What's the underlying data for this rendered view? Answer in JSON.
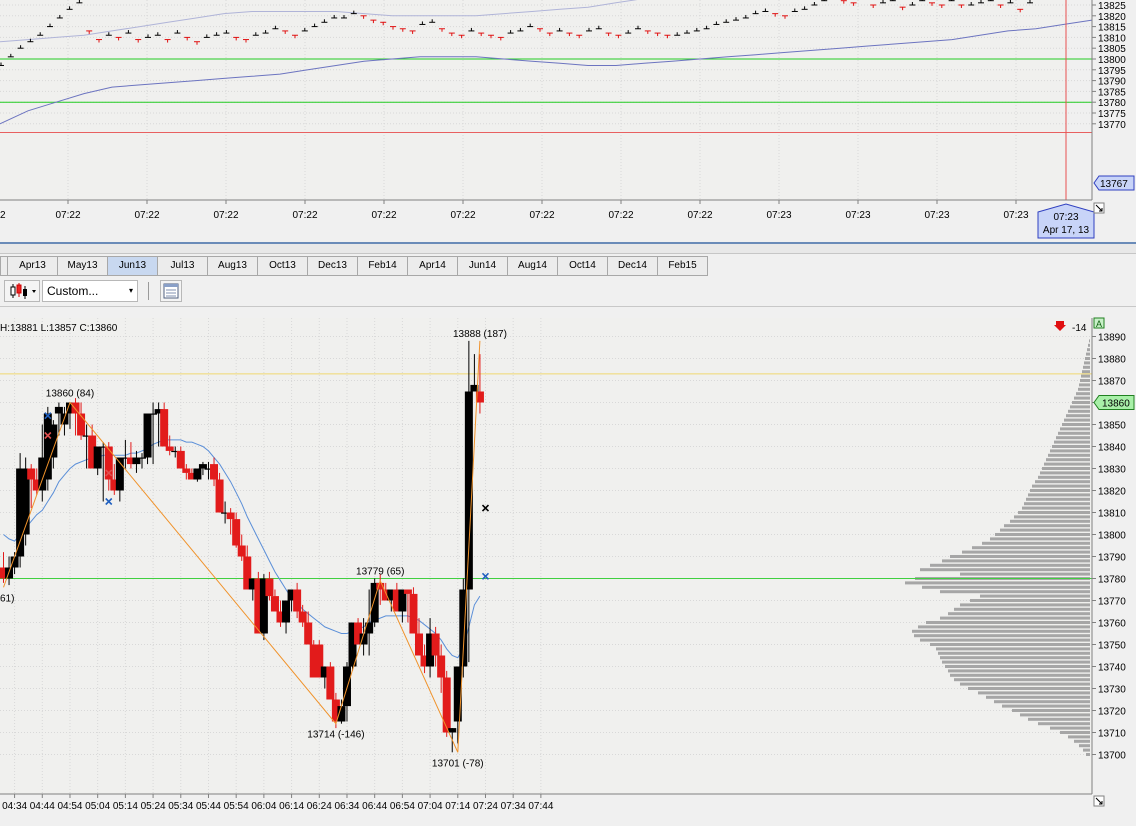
{
  "tick_chart": {
    "price_labels": [
      "13825",
      "13820",
      "13815",
      "13810",
      "13805",
      "13800",
      "13795",
      "13790",
      "13785",
      "13780",
      "13775",
      "13770"
    ],
    "time_labels": [
      "07:22",
      "07:22",
      "07:22",
      "07:22",
      "07:22",
      "07:22",
      "07:22",
      "07:22",
      "07:22",
      "07:23",
      "07:23",
      "07:23",
      "07:23"
    ],
    "left_edge_label": "2",
    "current_price": "13767",
    "cursor_time": "07:23",
    "cursor_date": "Apr 17, 13",
    "colors": {
      "line": "#22cc22",
      "upper_band": "#b0b4d8",
      "lower_band": "#6c74c0",
      "up_tick": "#000000",
      "down_tick": "#e01010",
      "price_badge": "#c8d4f8"
    }
  },
  "contract_tabs": [
    "Apr13",
    "May13",
    "Jun13",
    "Jul13",
    "Aug13",
    "Oct13",
    "Dec13",
    "Feb14",
    "Apr14",
    "Jun14",
    "Aug14",
    "Oct14",
    "Dec14",
    "Feb15"
  ],
  "selected_contract": "Jun13",
  "toolbar": {
    "template_label": "Custom...",
    "template_chevron": "▾"
  },
  "main_chart": {
    "ohlc_text": "H:13881 L:13857 C:13860",
    "price_labels": [
      "13890",
      "13880",
      "13870",
      "13860",
      "13850",
      "13840",
      "13830",
      "13820",
      "13810",
      "13800",
      "13790",
      "13780",
      "13770",
      "13760",
      "13750",
      "13740",
      "13730",
      "13720",
      "13710",
      "13700"
    ],
    "time_labels": [
      "04:34",
      "04:44",
      "04:54",
      "05:04",
      "05:14",
      "05:24",
      "05:34",
      "05:44",
      "05:54",
      "06:04",
      "06:14",
      "06:24",
      "06:34",
      "06:44",
      "06:54",
      "07:04",
      "07:14",
      "07:24",
      "07:34",
      "07:44"
    ],
    "current_price": "13860",
    "net_change": "-14",
    "axis_button": "A",
    "swing_labels": [
      "13860 (84)",
      "13714 (-146)",
      "13779 (65)",
      "13701 (-78)",
      "13888 (187)"
    ],
    "left_swing_fragment": "61)",
    "colors": {
      "up": "#000000",
      "down": "#e21b1b",
      "ma": "#5b8fd8",
      "zigzag": "#f0922a",
      "level": "#40d040",
      "price_badge": "#a8f0a8"
    }
  },
  "chart_data": [
    {
      "type": "candlestick",
      "title": "",
      "xlabel": "",
      "ylabel": "",
      "x": [
        "04:30",
        "04:32",
        "04:34",
        "04:36",
        "04:38",
        "04:40",
        "04:42",
        "04:44",
        "04:46",
        "04:48",
        "04:50",
        "04:52",
        "04:54",
        "04:56",
        "04:58",
        "05:00",
        "05:02",
        "05:04",
        "05:06",
        "05:08",
        "05:10",
        "05:12",
        "05:14",
        "05:16",
        "05:18",
        "05:20",
        "05:22",
        "05:24",
        "05:26",
        "05:28",
        "05:30",
        "05:32",
        "05:34",
        "05:36",
        "05:38",
        "05:40",
        "05:42",
        "05:44",
        "05:46",
        "05:48",
        "05:50",
        "05:52",
        "05:54",
        "05:56",
        "05:58",
        "06:00",
        "06:02",
        "06:04",
        "06:06",
        "06:08",
        "06:10",
        "06:12",
        "06:14",
        "06:16",
        "06:18",
        "06:20",
        "06:22",
        "06:24",
        "06:26",
        "06:28",
        "06:30",
        "06:32",
        "06:34",
        "06:36",
        "06:38",
        "06:40",
        "06:42",
        "06:44",
        "06:46",
        "06:48",
        "06:50",
        "06:52",
        "06:54",
        "06:56",
        "06:58",
        "07:00",
        "07:02",
        "07:04",
        "07:06",
        "07:08",
        "07:10",
        "07:12",
        "07:14",
        "07:16",
        "07:18",
        "07:20",
        "07:22",
        "07:24"
      ],
      "open": [
        13785,
        13780,
        13785,
        13790,
        13800,
        13830,
        13825,
        13820,
        13825,
        13835,
        13855,
        13850,
        13855,
        13860,
        13855,
        13845,
        13845,
        13830,
        13840,
        13840,
        13825,
        13820,
        13835,
        13835,
        13832,
        13835,
        13835,
        13855,
        13855,
        13857,
        13840,
        13838,
        13838,
        13830,
        13828,
        13825,
        13830,
        13830,
        13832,
        13825,
        13810,
        13810,
        13807,
        13795,
        13790,
        13775,
        13780,
        13755,
        13780,
        13772,
        13765,
        13760,
        13770,
        13775,
        13765,
        13760,
        13750,
        13750,
        13735,
        13740,
        13725,
        13715,
        13722,
        13740,
        13760,
        13750,
        13755,
        13760,
        13778,
        13775,
        13770,
        13775,
        13765,
        13775,
        13773,
        13755,
        13745,
        13740,
        13755,
        13745,
        13735,
        13710,
        13715,
        13740,
        13775,
        13865,
        13865
      ],
      "high": [
        13792,
        13790,
        13792,
        13837,
        13835,
        13832,
        13830,
        13850,
        13858,
        13852,
        13860,
        13858,
        13860,
        13862,
        13860,
        13850,
        13850,
        13840,
        13842,
        13842,
        13832,
        13826,
        13843,
        13842,
        13838,
        13837,
        13840,
        13860,
        13860,
        13860,
        13845,
        13840,
        13840,
        13832,
        13830,
        13830,
        13833,
        13833,
        13835,
        13828,
        13815,
        13812,
        13810,
        13800,
        13795,
        13780,
        13783,
        13782,
        13783,
        13775,
        13770,
        13765,
        13775,
        13778,
        13768,
        13765,
        13752,
        13752,
        13740,
        13742,
        13728,
        13725,
        13742,
        13760,
        13762,
        13762,
        13775,
        13780,
        13782,
        13778,
        13775,
        13778,
        13775,
        13775,
        13776,
        13762,
        13750,
        13762,
        13758,
        13750,
        13738,
        13712,
        13740,
        13780,
        13888,
        13882,
        13882
      ],
      "low": [
        13778,
        13777,
        13782,
        13785,
        13795,
        13812,
        13818,
        13815,
        13820,
        13830,
        13845,
        13845,
        13848,
        13845,
        13843,
        13830,
        13830,
        13827,
        13815,
        13820,
        13818,
        13815,
        13830,
        13830,
        13828,
        13830,
        13832,
        13832,
        13840,
        13853,
        13836,
        13835,
        13830,
        13825,
        13825,
        13824,
        13827,
        13825,
        13822,
        13810,
        13805,
        13800,
        13794,
        13788,
        13775,
        13770,
        13768,
        13752,
        13770,
        13765,
        13758,
        13755,
        13765,
        13762,
        13758,
        13750,
        13735,
        13735,
        13730,
        13725,
        13712,
        13714,
        13715,
        13738,
        13750,
        13745,
        13745,
        13758,
        13768,
        13770,
        13765,
        13767,
        13760,
        13760,
        13755,
        13745,
        13737,
        13735,
        13740,
        13728,
        13708,
        13701,
        13705,
        13735,
        13742,
        13865,
        13855
      ],
      "close": [
        13780,
        13785,
        13790,
        13830,
        13830,
        13825,
        13820,
        13835,
        13855,
        13850,
        13858,
        13855,
        13860,
        13855,
        13845,
        13845,
        13830,
        13840,
        13840,
        13825,
        13820,
        13835,
        13835,
        13832,
        13835,
        13835,
        13855,
        13855,
        13857,
        13840,
        13838,
        13838,
        13830,
        13828,
        13825,
        13830,
        13832,
        13830,
        13825,
        13810,
        13810,
        13807,
        13795,
        13790,
        13775,
        13780,
        13755,
        13780,
        13772,
        13765,
        13760,
        13770,
        13775,
        13765,
        13760,
        13750,
        13735,
        13735,
        13740,
        13725,
        13715,
        13722,
        13740,
        13760,
        13750,
        13755,
        13760,
        13778,
        13775,
        13770,
        13775,
        13765,
        13775,
        13773,
        13755,
        13745,
        13740,
        13755,
        13745,
        13735,
        13710,
        13712,
        13740,
        13775,
        13865,
        13868,
        13860
      ],
      "series": [
        {
          "name": "",
          "kind": "moving-average",
          "values": [
            13800,
            13798,
            13797,
            13800,
            13803,
            13806,
            13809,
            13811,
            13815,
            13819,
            13824,
            13827,
            13830,
            13832,
            13833,
            13834,
            13835,
            13835,
            13836,
            13836,
            13836,
            13836,
            13836,
            13837,
            13837,
            13838,
            13839,
            13841,
            13842,
            13843,
            13843,
            13843,
            13843,
            13842,
            13842,
            13841,
            13840,
            13838,
            13835,
            13832,
            13828,
            13824,
            13819,
            13814,
            13808,
            13803,
            13798,
            13793,
            13788,
            13783,
            13779,
            13775,
            13771,
            13769,
            13766,
            13764,
            13762,
            13760,
            13758,
            13757,
            13756,
            13755,
            13755,
            13756,
            13757,
            13758,
            13760,
            13761,
            13762,
            13763,
            13763,
            13763,
            13763,
            13763,
            13762,
            13761,
            13759,
            13757,
            13755,
            13752,
            13748,
            13745,
            13744,
            13748,
            13758,
            13768,
            13772
          ]
        },
        {
          "name": "",
          "kind": "zigzag",
          "x": [
            "04:30",
            "04:54",
            "06:30",
            "06:46",
            "07:14",
            "07:22"
          ],
          "values": [
            13776,
            13860,
            13714,
            13779,
            13701,
            13888
          ]
        }
      ],
      "horizontal_lines": [
        13780,
        13873
      ],
      "volume_profile": {
        "prices": [
          13700,
          13702,
          13704,
          13706,
          13708,
          13710,
          13712,
          13714,
          13716,
          13718,
          13720,
          13722,
          13724,
          13726,
          13728,
          13730,
          13732,
          13734,
          13736,
          13738,
          13740,
          13742,
          13744,
          13746,
          13748,
          13750,
          13752,
          13754,
          13756,
          13758,
          13760,
          13762,
          13764,
          13766,
          13768,
          13770,
          13772,
          13774,
          13776,
          13778,
          13780,
          13782,
          13784,
          13786,
          13788,
          13790,
          13792,
          13794,
          13796,
          13798,
          13800,
          13802,
          13804,
          13806,
          13808,
          13810,
          13812,
          13814,
          13816,
          13818,
          13820,
          13822,
          13824,
          13826,
          13828,
          13830,
          13832,
          13834,
          13836,
          13838,
          13840,
          13842,
          13844,
          13846,
          13848,
          13850,
          13852,
          13854,
          13856,
          13858,
          13860,
          13862,
          13864,
          13866,
          13868,
          13870,
          13872,
          13874,
          13876,
          13878,
          13880,
          13882,
          13884,
          13886,
          13888
        ],
        "volumes": [
          4,
          7,
          11,
          16,
          22,
          30,
          40,
          52,
          62,
          70,
          78,
          88,
          96,
          104,
          112,
          122,
          130,
          136,
          140,
          142,
          145,
          148,
          150,
          152,
          154,
          160,
          170,
          176,
          178,
          172,
          164,
          150,
          142,
          136,
          130,
          120,
          110,
          150,
          168,
          185,
          175,
          130,
          170,
          160,
          148,
          140,
          128,
          118,
          108,
          100,
          95,
          90,
          86,
          80,
          76,
          72,
          68,
          66,
          64,
          62,
          60,
          58,
          55,
          52,
          50,
          48,
          46,
          44,
          42,
          40,
          38,
          36,
          34,
          32,
          30,
          28,
          26,
          24,
          22,
          20,
          18,
          16,
          14,
          12,
          11,
          10,
          9,
          8,
          7,
          6,
          5,
          4,
          3,
          2,
          1
        ]
      },
      "markers": [
        {
          "x": "04:46",
          "price": 13854,
          "symbol": "×",
          "color": "#2060c0"
        },
        {
          "x": "04:46",
          "price": 13845,
          "symbol": "×",
          "color": "#e05050"
        },
        {
          "x": "05:08",
          "price": 13828,
          "symbol": "×",
          "color": "#e05050"
        },
        {
          "x": "05:08",
          "price": 13815,
          "symbol": "×",
          "color": "#2060c0"
        },
        {
          "x": "07:24",
          "price": 13812,
          "symbol": "×",
          "color": "#000000"
        },
        {
          "x": "07:24",
          "price": 13781,
          "symbol": "×",
          "color": "#2060c0"
        }
      ],
      "ylim": [
        13695,
        13895
      ]
    },
    {
      "type": "scatter",
      "title": "",
      "x_count": 106,
      "values": [
        13797,
        13801,
        13805,
        13808,
        13811,
        13815,
        13819,
        13823,
        13826,
        13813,
        13809,
        13811,
        13810,
        13812,
        13809,
        13810,
        13811,
        13809,
        13812,
        13810,
        13808,
        13810,
        13811,
        13812,
        13810,
        13809,
        13811,
        13812,
        13814,
        13813,
        13811,
        13813,
        13815,
        13817,
        13819,
        13819,
        13821,
        13820,
        13818,
        13817,
        13815,
        13814,
        13813,
        13816,
        13817,
        13814,
        13812,
        13811,
        13813,
        13812,
        13811,
        13810,
        13812,
        13813,
        13815,
        13814,
        13812,
        13813,
        13812,
        13811,
        13813,
        13814,
        13812,
        13811,
        13812,
        13814,
        13813,
        13812,
        13811,
        13811,
        13812,
        13813,
        13814,
        13816,
        13817,
        13818,
        13819,
        13821,
        13822,
        13821,
        13820,
        13822,
        13823,
        13825,
        13827,
        13828,
        13827,
        13826,
        13828,
        13825,
        13826,
        13827,
        13824,
        13825,
        13827,
        13826,
        13825,
        13827,
        13825,
        13825,
        13826,
        13827,
        13825,
        13826,
        13823,
        13826
      ],
      "series": [
        {
          "name": "",
          "kind": "upper-band",
          "values": [
            13808,
            13809,
            13810,
            13811,
            13813,
            13815,
            13817,
            13819,
            13821,
            13822,
            13822,
            13822,
            13822,
            13821,
            13820,
            13820,
            13820,
            13820,
            13821,
            13822,
            13823,
            13824,
            13826,
            13828,
            13829,
            13830,
            13831,
            13831,
            13831,
            13831,
            13832,
            13832,
            13832,
            13832,
            13832,
            13832,
            13832,
            13832,
            13832,
            13832
          ]
        },
        {
          "name": "",
          "kind": "lower-band",
          "values": [
            13770,
            13776,
            13780,
            13784,
            13787,
            13788,
            13789,
            13790,
            13791,
            13792,
            13793,
            13795,
            13797,
            13799,
            13800,
            13801,
            13801,
            13801,
            13800,
            13799,
            13798,
            13797,
            13797,
            13798,
            13799,
            13800,
            13801,
            13802,
            13803,
            13804,
            13805,
            13806,
            13807,
            13808,
            13809,
            13811,
            13813,
            13814,
            13816,
            13818
          ]
        }
      ],
      "horizontal_lines": [
        13800,
        13780,
        13766
      ],
      "ylim": [
        13763.5,
        13827
      ]
    }
  ]
}
